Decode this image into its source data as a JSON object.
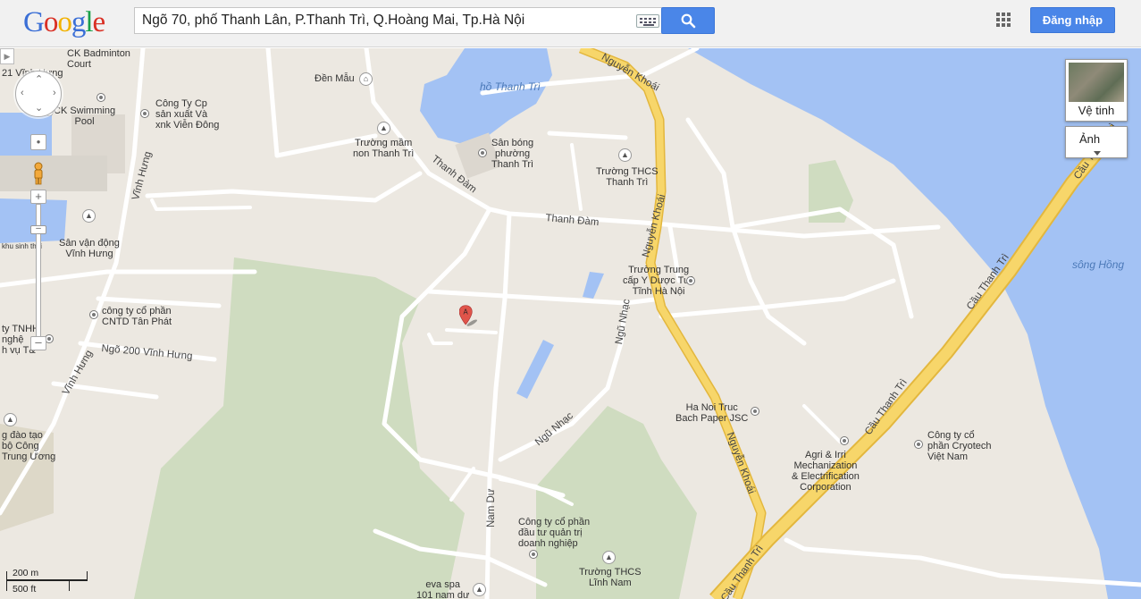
{
  "header": {
    "logo": {
      "g1": "G",
      "o1": "o",
      "o2": "o",
      "g2": "g",
      "l": "l",
      "e": "e"
    },
    "search_value": "Ngõ 70, phố Thanh Lân, P.Thanh Trì, Q.Hoàng Mai, Tp.Hà Nội",
    "signin_label": "Đăng nhập"
  },
  "icons": {
    "search": "search-icon",
    "keyboard": "keyboard-icon",
    "apps": "apps-grid-icon",
    "pegman": "pegman-icon"
  },
  "colors": {
    "accent": "#4a86e8",
    "land": "#ece8e1",
    "park": "#cfdcc0",
    "water": "#a3c2f4",
    "highway": "#f7d66a",
    "marker": "#e0544a"
  },
  "map_controls": {
    "satellite_label": "Vệ tinh",
    "imagery_label": "Ảnh",
    "scale_metric": "200 m",
    "scale_imperial": "500 ft",
    "marker_label": "A"
  },
  "labels": {
    "ck_badminton": "CK Badminton\nCourt",
    "vinh_hung_top": "21 Vĩnh Hưng",
    "den_mau": "Đền Mẫu",
    "cong_ty_cp": "Công Ty Cp\nsản xuất Và\nxnk Viễn Đông",
    "ck_swimming": "CK Swimming\nPool",
    "truong_mam_non": "Trường mầm\nnon Thanh Trì",
    "ho_thanh_tri": "hồ Thanh Trì",
    "san_bong": "Sân bóng\nphường\nThanh Trì",
    "truong_thcs_tt": "Trường THCS\nThanh Trì",
    "thanh_dam_1": "Thanh Đàm",
    "thanh_dam_2": "Thanh Đàm",
    "nguyen_khoai_1": "Nguyễn Khoái",
    "nguyen_khoai_2": "Nguyễn Khoái",
    "nguyen_khoai_3": "Nguyễn Khoái",
    "vinh_hung_road_1": "Vĩnh Hưng",
    "vinh_hung_road_2": "Vĩnh Hưng",
    "san_van_dong": "Sân vận động\nVĩnh Hưng",
    "khu_sinh_thai": "khu sinh thái",
    "truong_trung_cap": "Trường Trung\ncấp Y Dược Tuệ\nTĩnh Hà Nội",
    "song_hong": "sông Hồng",
    "cau_thanh_tri_1": "Cầu Thanh Trì",
    "cau_thanh_tri_2": "Cầu Thanh Trì",
    "cau_thanh_tri_3": "Cầu Thanh Trì",
    "cau_thanh_tri_4": "Cầu Thanh Trì",
    "cntd_tan_phat": "công ty cổ phần\nCNTD Tân Phát",
    "ngo_200": "Ngõ 200 Vĩnh Hưng",
    "cty_tnhh": "ty TNHH\nnghệ\nh vụ T&",
    "ngu_nhac_1": "Ngũ Nhạc",
    "ngu_nhac_2": "Ngũ Nhạc",
    "hanoi_truc_bach": "Ha Noi Truc\nBach Paper JSC",
    "cryotech": "Công ty cổ\nphần Cryotech\nViệt Nam",
    "agri_irri": "Agri & Irri\nMechanization\n& Electrification\nCorporation",
    "dao_tao": "g đào tạo\nbộ Công\nTrung Ương",
    "nam_du": "Nam Dư",
    "dau_tu": "Công ty cổ phần\nđầu tư quản trị\ndoanh nghiệp",
    "truong_linh_nam": "Trường THCS\nLĩnh Nam",
    "eva_spa": "eva spa\n101 nam dư"
  }
}
